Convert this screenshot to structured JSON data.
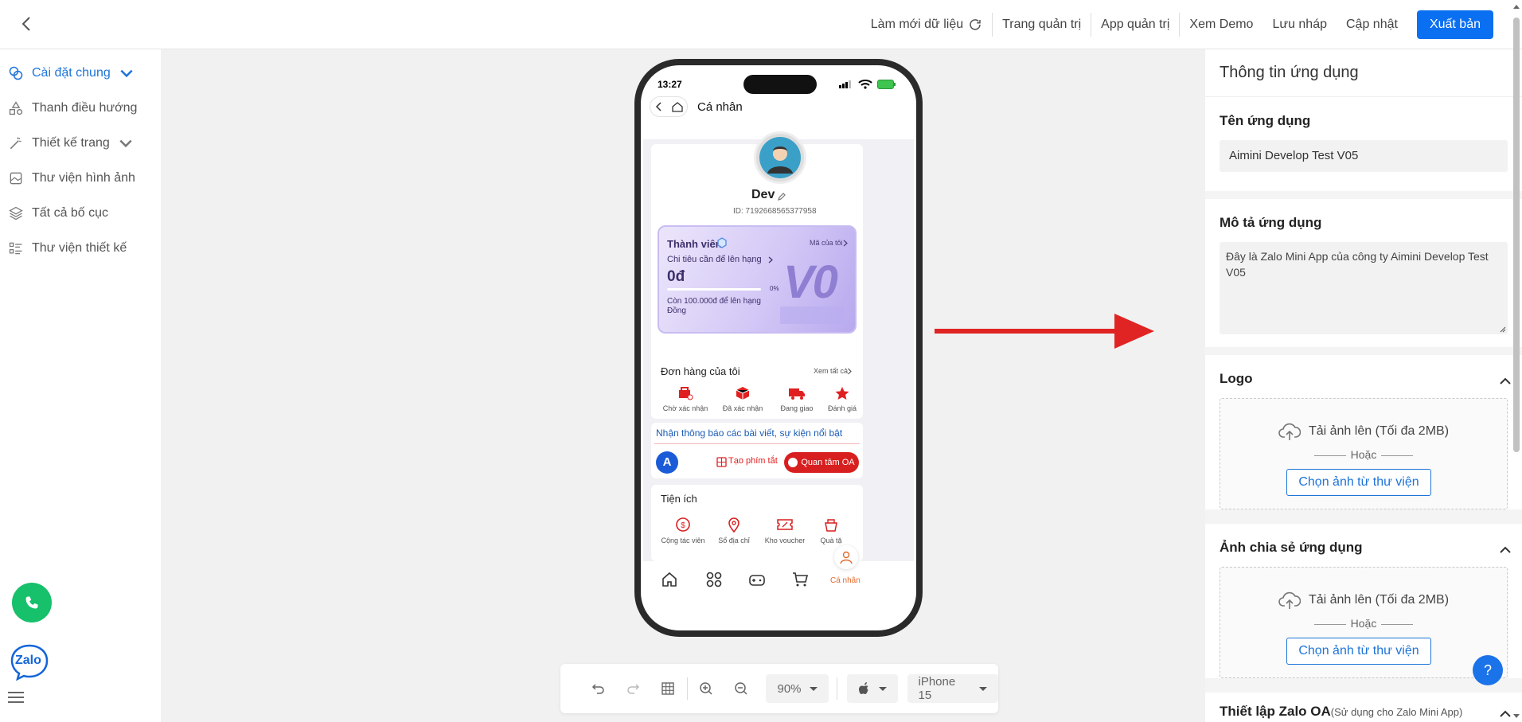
{
  "topbar": {
    "refresh_label": "Làm mới dữ liệu",
    "admin_label": "Trang quản trị",
    "admin_app_label": "App quản trị",
    "demo_label": "Xem Demo",
    "draft_label": "Lưu nháp",
    "update_label": "Cập nhật",
    "publish_label": "Xuất bản"
  },
  "sidebar": {
    "items": [
      {
        "label": "Cài đặt chung",
        "icon": "settings-link-icon"
      },
      {
        "label": "Thanh điều hướng",
        "icon": "shapes-icon"
      },
      {
        "label": "Thiết kế trang",
        "icon": "magic-wand-icon"
      },
      {
        "label": "Thư viện hình ảnh",
        "icon": "images-icon"
      },
      {
        "label": "Tất cả bố cục",
        "icon": "layers-icon"
      },
      {
        "label": "Thư viện thiết kế",
        "icon": "list-icon"
      }
    ],
    "zalo_logo": "Zalo"
  },
  "phone": {
    "time": "13:27",
    "page_title": "Cá nhân",
    "user_name": "Dev",
    "user_id": "ID: 7192668565377958",
    "member": {
      "title": "Thành viên",
      "my_code": "Mã của tôi",
      "spend_label": "Chi tiêu cần để lên hạng",
      "amount": "0đ",
      "percent": "0%",
      "remaining": "Còn 100.000đ để lên hạng Đồng",
      "tier": "V0"
    },
    "orders": {
      "title": "Đơn hàng của tôi",
      "see_all": "Xem tất cả",
      "items": [
        "Chờ xác nhận",
        "Đã xác nhận",
        "Đang giao",
        "Đánh giá"
      ]
    },
    "notify": {
      "text": "Nhận thông báo các bài viết, sự kiện nổi bật",
      "shortcut": "Tạo phím tắt",
      "follow": "Quan tâm OA",
      "avatar_letter": "A"
    },
    "utilities": {
      "title": "Tiện ích",
      "items": [
        "Cộng tác viên",
        "Sổ địa chỉ",
        "Kho voucher",
        "Quà tặ"
      ]
    },
    "nav_active": "Cá nhân"
  },
  "toolbar": {
    "zoom": "90%",
    "device": "iPhone 15"
  },
  "panel": {
    "title": "Thông tin ứng dụng",
    "app_name_label": "Tên ứng dụng",
    "app_name_value": "Aimini Develop Test V05",
    "app_desc_label": "Mô tả ứng dụng",
    "app_desc_value": "Đây là Zalo Mini App của công ty Aimini Develop Test V05",
    "logo_label": "Logo",
    "upload_label": "Tải ảnh lên (Tối đa 2MB)",
    "or_label": "Hoặc",
    "pick_label": "Chọn ảnh từ thư viện",
    "share_label": "Ảnh chia sẻ ứng dụng",
    "upload_label2": "Tải ảnh lên (Tối đa 2MB)",
    "or_label2": "Hoặc",
    "pick_label2": "Chọn ảnh từ thư viện",
    "oa_label": "Thiết lập Zalo OA",
    "oa_note": "(Sử dụng cho Zalo Mini App)"
  },
  "help_label": "?",
  "colors": {
    "accent": "#0a6ff0",
    "red": "#e02020",
    "link": "#1e74d8"
  }
}
